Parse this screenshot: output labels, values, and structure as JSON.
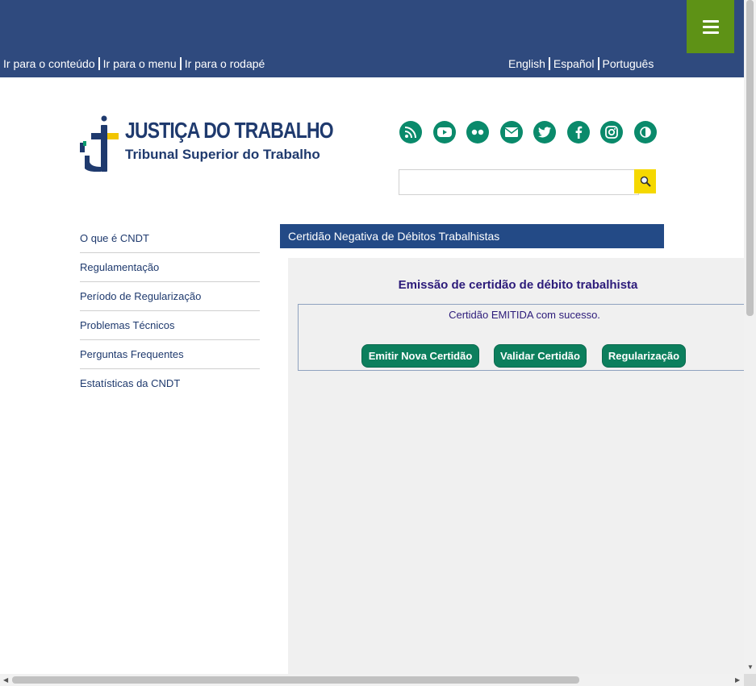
{
  "header": {
    "skip_links": [
      "Ir para o conteúdo",
      "Ir para o menu",
      "Ir para o rodapé"
    ],
    "languages": [
      "English",
      "Español",
      "Português"
    ],
    "menu_icon": "hamburger-icon"
  },
  "logo": {
    "title": "JUSTIÇA DO TRABALHO",
    "subtitle": "Tribunal Superior do Trabalho"
  },
  "social_icons": [
    "rss-icon",
    "youtube-icon",
    "flickr-icon",
    "email-icon",
    "twitter-icon",
    "facebook-icon",
    "instagram-icon",
    "contrast-icon"
  ],
  "search": {
    "placeholder": "",
    "button_icon": "search-icon"
  },
  "sidebar": {
    "items": [
      {
        "label": "O que é CNDT"
      },
      {
        "label": "Regulamentação"
      },
      {
        "label": "Período de Regularização"
      },
      {
        "label": "Problemas Técnicos"
      },
      {
        "label": "Perguntas Frequentes"
      },
      {
        "label": "Estatísticas da CNDT"
      }
    ]
  },
  "main": {
    "section_title": "Certidão Negativa de Débitos Trabalhistas",
    "heading": "Emissão de certidão de débito trabalhista",
    "message": "Certidão EMITIDA com sucesso.",
    "buttons": {
      "emitir": "Emitir Nova Certidão",
      "validar": "Validar Certidão",
      "regularizacao": "Regularização"
    }
  },
  "colors": {
    "topbar": "#2f4a7e",
    "menu_button": "#5e9216",
    "social_icons": "#0a8a6b",
    "action_buttons": "#0c7f5d",
    "section_bar": "#234a86"
  }
}
